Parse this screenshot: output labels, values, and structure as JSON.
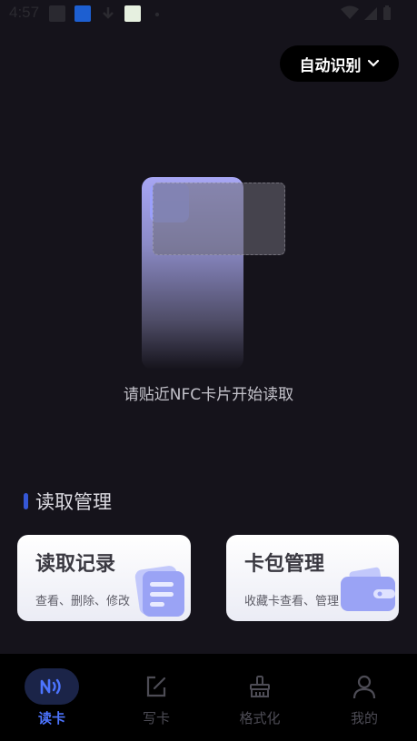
{
  "status_bar": {
    "time": "4:57"
  },
  "header": {
    "mode_label": "自动识别"
  },
  "main": {
    "hint": "请贴近NFC卡片开始读取"
  },
  "section": {
    "title": "读取管理"
  },
  "tiles": [
    {
      "title": "读取记录",
      "subtitle": "查看、删除、修改"
    },
    {
      "title": "卡包管理",
      "subtitle": "收藏卡查看、管理"
    }
  ],
  "tabs": [
    {
      "label": "读卡",
      "icon": "nfc-icon",
      "active": true
    },
    {
      "label": "写卡",
      "icon": "edit-icon",
      "active": false
    },
    {
      "label": "格式化",
      "icon": "broom-icon",
      "active": false
    },
    {
      "label": "我的",
      "icon": "user-icon",
      "active": false
    }
  ],
  "colors": {
    "background": "#15131b",
    "accent": "#4c74ff",
    "tabbar": "#000000"
  }
}
